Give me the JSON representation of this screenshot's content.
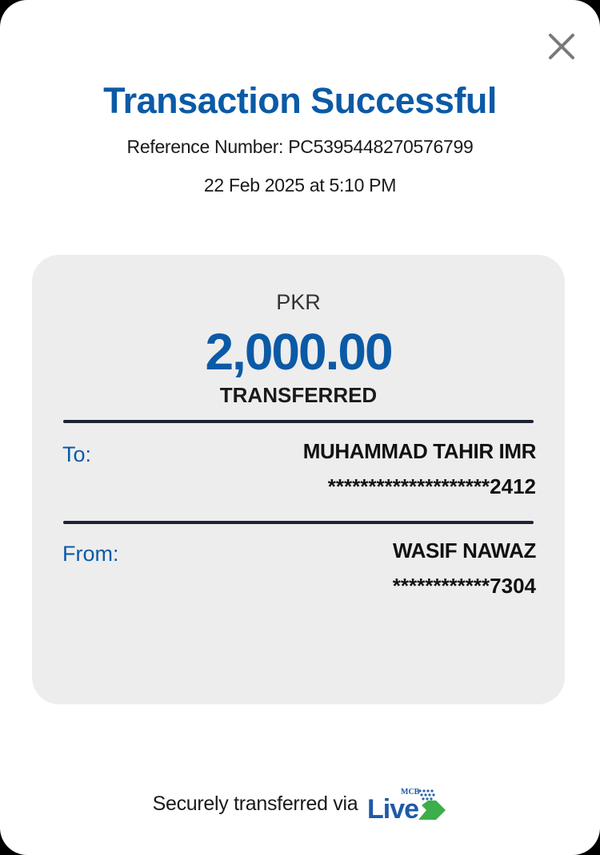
{
  "colors": {
    "brand_blue": "#0b5aa6",
    "logo_green": "#3cae4a",
    "card_bg": "#ededee"
  },
  "header": {
    "close_icon": "close-icon",
    "title": "Transaction Successful",
    "reference": "Reference Number: PC5395448270576799",
    "datetime": "22 Feb 2025 at 5:10 PM"
  },
  "card": {
    "currency": "PKR",
    "amount": "2,000.00",
    "status": "TRANSFERRED",
    "to": {
      "label": "To:",
      "name": "MUHAMMAD TAHIR IMR",
      "account": "********************2412"
    },
    "from": {
      "label": "From:",
      "name": "WASIF NAWAZ",
      "account": "************7304"
    }
  },
  "footer": {
    "text": "Securely transferred via",
    "logo_text": "Live",
    "logo_small_text": "MCB"
  }
}
